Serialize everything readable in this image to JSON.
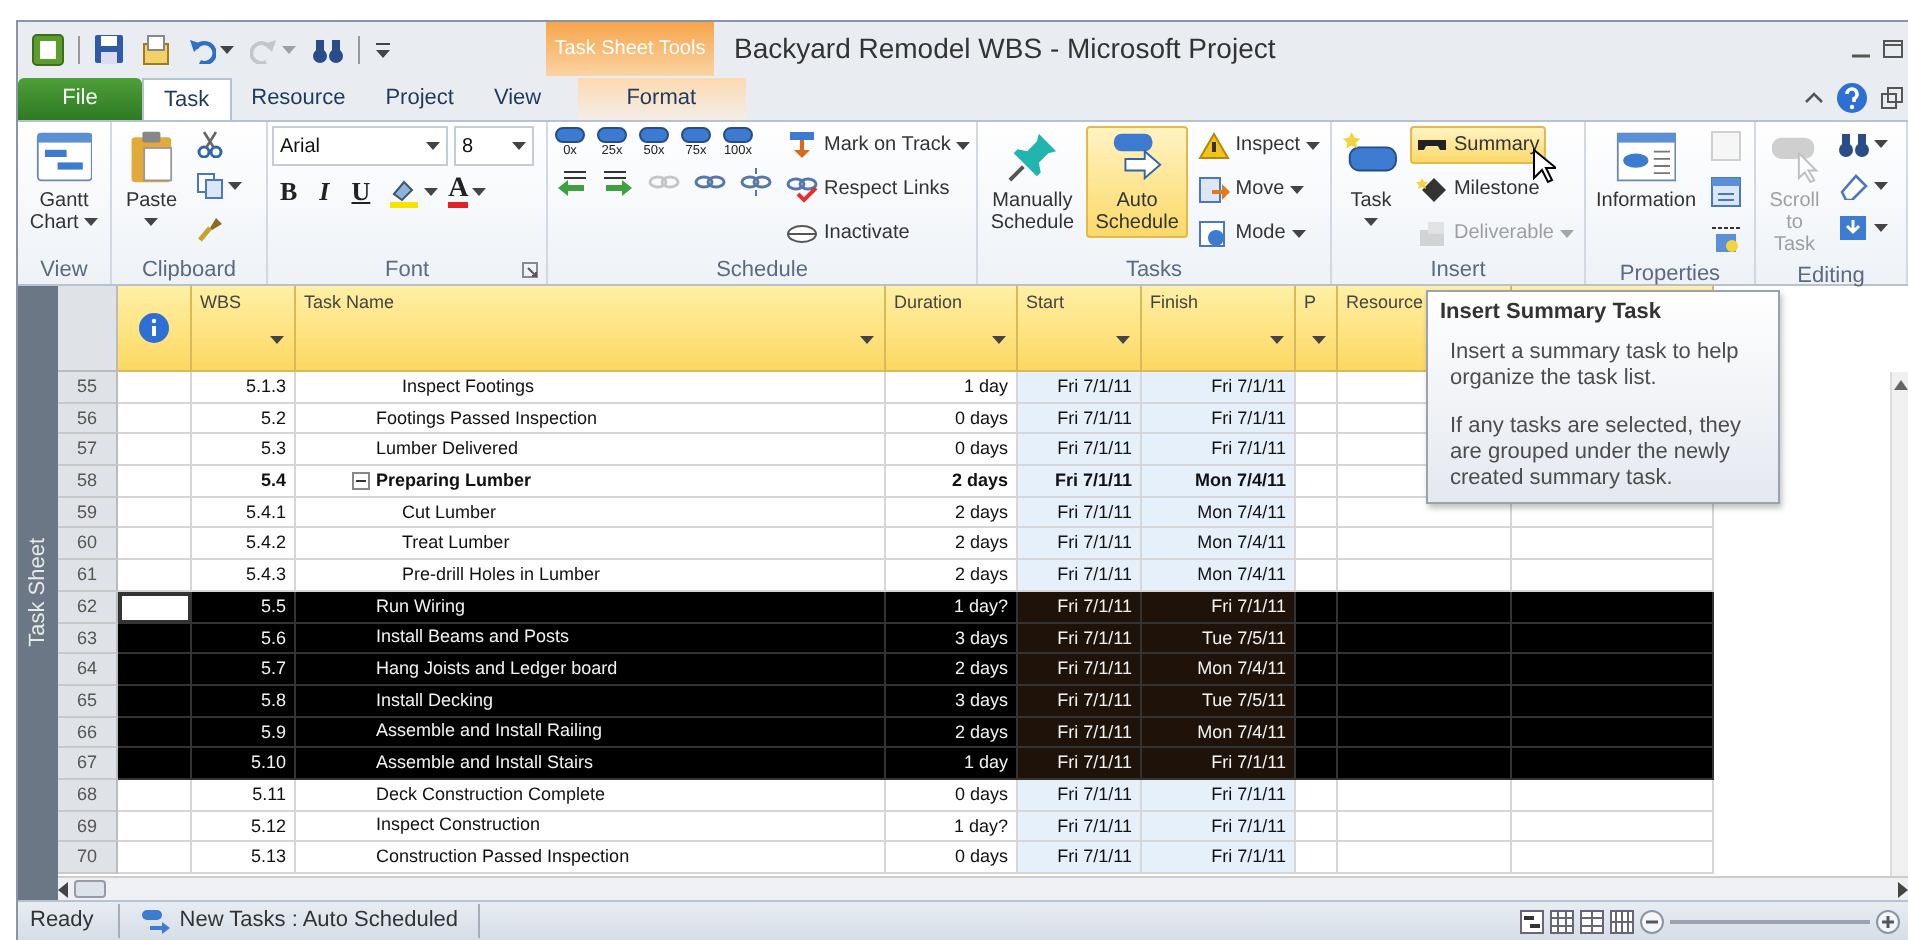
{
  "window": {
    "title": "Backyard Remodel WBS - Microsoft Project",
    "context_tab_group": "Task Sheet Tools"
  },
  "quick_access": [
    {
      "dropdown": false,
      "disabled": false
    },
    {
      "dropdown": false,
      "disabled": false
    },
    {
      "dropdown": false,
      "disabled": false
    },
    {
      "dropdown": true,
      "disabled": false
    },
    {
      "dropdown": true,
      "disabled": true
    },
    {
      "dropdown": false,
      "disabled": false
    },
    {
      "dropdown": false,
      "disabled": false
    }
  ],
  "tabs": [
    {
      "label": "File",
      "kind": "file",
      "selected": false
    },
    {
      "label": "Task",
      "kind": "normal",
      "selected": true
    },
    {
      "label": "Resource",
      "kind": "normal",
      "selected": false
    },
    {
      "label": "Project",
      "kind": "normal",
      "selected": false
    },
    {
      "label": "View",
      "kind": "normal",
      "selected": false
    },
    {
      "label": "Format",
      "kind": "contextual",
      "selected": false
    }
  ],
  "ribbon": [
    {
      "name": "View",
      "columns": [
        [
          [
            {
              "kind": "large",
              "label": "Gantt Chart",
              "dropdown": true,
              "disabled": false,
              "highlighted": false
            }
          ]
        ]
      ]
    },
    {
      "name": "Clipboard",
      "columns": [
        [
          [
            {
              "kind": "large",
              "label": "Paste",
              "dropdown": true,
              "disabled": false,
              "highlighted": false
            }
          ]
        ],
        [
          [
            {
              "kind": "icon",
              "dropdown": false,
              "disabled": false,
              "highlighted": false
            }
          ],
          [
            {
              "kind": "icon",
              "dropdown": true,
              "disabled": false,
              "highlighted": false
            }
          ],
          [
            {
              "kind": "icon",
              "dropdown": false,
              "disabled": false,
              "highlighted": false
            }
          ]
        ]
      ]
    },
    {
      "name": "Font",
      "launcher": true,
      "columns": [
        [
          [
            {
              "kind": "field",
              "value": "Arial",
              "dropdown": true,
              "disabled": false
            },
            {
              "kind": "field",
              "value": "8",
              "dropdown": true,
              "disabled": false
            }
          ],
          [
            {
              "kind": "format",
              "label": "B",
              "disabled": false
            },
            {
              "kind": "format",
              "label": "I",
              "disabled": false
            },
            {
              "kind": "format",
              "label": "U",
              "disabled": false
            },
            {
              "kind": "icon",
              "dropdown": true,
              "disabled": false,
              "highlighted": false
            },
            {
              "kind": "color",
              "label": "A",
              "dropdown": true,
              "disabled": false,
              "highlighted": false
            }
          ]
        ]
      ]
    },
    {
      "name": "Schedule",
      "columns": [
        [
          [
            {
              "kind": "percent",
              "label": "0x",
              "disabled": false
            },
            {
              "kind": "percent",
              "label": "25x",
              "disabled": false
            },
            {
              "kind": "percent",
              "label": "50x",
              "disabled": false
            },
            {
              "kind": "percent",
              "label": "75x",
              "disabled": false
            },
            {
              "kind": "percent",
              "label": "100x",
              "disabled": false
            }
          ],
          [
            {
              "kind": "icon",
              "dropdown": false,
              "disabled": false,
              "highlighted": false
            },
            {
              "kind": "icon",
              "dropdown": false,
              "disabled": false,
              "highlighted": false
            },
            {
              "kind": "icon",
              "dropdown": false,
              "disabled": true,
              "highlighted": false
            },
            {
              "kind": "icon",
              "dropdown": false,
              "disabled": false,
              "highlighted": false
            },
            {
              "kind": "icon",
              "dropdown": false,
              "disabled": false,
              "highlighted": false
            }
          ]
        ],
        [
          [
            {
              "kind": "small",
              "label": "Mark on Track",
              "dropdown": true,
              "disabled": false,
              "highlighted": false
            }
          ],
          [
            {
              "kind": "small",
              "label": "Respect Links",
              "dropdown": false,
              "disabled": false,
              "highlighted": false
            }
          ],
          [
            {
              "kind": "small",
              "label": "Inactivate",
              "dropdown": false,
              "disabled": false,
              "highlighted": false
            }
          ]
        ]
      ]
    },
    {
      "name": "Tasks",
      "columns": [
        [
          [
            {
              "kind": "large",
              "label": "Manually Schedule",
              "dropdown": false,
              "disabled": false,
              "highlighted": false
            }
          ]
        ],
        [
          [
            {
              "kind": "large",
              "label": "Auto Schedule",
              "dropdown": false,
              "disabled": false,
              "highlighted": true
            }
          ]
        ],
        [
          [
            {
              "kind": "small",
              "label": "Inspect",
              "dropdown": true,
              "disabled": false,
              "highlighted": false
            }
          ],
          [
            {
              "kind": "small",
              "label": "Move",
              "dropdown": true,
              "disabled": false,
              "highlighted": false
            }
          ],
          [
            {
              "kind": "small",
              "label": "Mode",
              "dropdown": true,
              "disabled": false,
              "highlighted": false
            }
          ]
        ]
      ]
    },
    {
      "name": "Insert",
      "columns": [
        [
          [
            {
              "kind": "large",
              "label": "Task",
              "dropdown": true,
              "disabled": false,
              "highlighted": false
            }
          ]
        ],
        [
          [
            {
              "kind": "small",
              "label": "Summary",
              "dropdown": false,
              "disabled": false,
              "highlighted": true
            }
          ],
          [
            {
              "kind": "small",
              "label": "Milestone",
              "dropdown": false,
              "disabled": false,
              "highlighted": false
            }
          ],
          [
            {
              "kind": "small",
              "label": "Deliverable",
              "dropdown": true,
              "disabled": true,
              "highlighted": false
            }
          ]
        ]
      ]
    },
    {
      "name": "Properties",
      "columns": [
        [
          [
            {
              "kind": "large",
              "label": "Information",
              "dropdown": false,
              "disabled": false,
              "highlighted": false
            }
          ]
        ],
        [
          [
            {
              "kind": "icon",
              "dropdown": false,
              "disabled": true,
              "highlighted": false
            }
          ],
          [
            {
              "kind": "icon",
              "dropdown": false,
              "disabled": false,
              "highlighted": false
            }
          ],
          [
            {
              "kind": "icon",
              "dropdown": false,
              "disabled": false,
              "highlighted": false
            }
          ]
        ]
      ]
    },
    {
      "name": "Editing",
      "columns": [
        [
          [
            {
              "kind": "large",
              "label": "Scroll to Task",
              "dropdown": false,
              "disabled": true,
              "highlighted": false
            }
          ]
        ],
        [
          [
            {
              "kind": "icon",
              "dropdown": true,
              "disabled": false,
              "highlighted": false
            }
          ],
          [
            {
              "kind": "icon",
              "dropdown": true,
              "disabled": false,
              "highlighted": false
            }
          ],
          [
            {
              "kind": "icon",
              "dropdown": true,
              "disabled": false,
              "highlighted": false
            }
          ]
        ]
      ]
    }
  ],
  "side_label": "Task Sheet",
  "table": {
    "columns": [
      {
        "kind": "indicator",
        "filter": false
      },
      {
        "label": "WBS",
        "kind": "wbs",
        "filter": true
      },
      {
        "label": "Task Name",
        "kind": "name",
        "filter": true
      },
      {
        "label": "Duration",
        "kind": "duration",
        "filter": true
      },
      {
        "label": "Start",
        "kind": "date",
        "filter": true
      },
      {
        "label": "Finish",
        "kind": "date",
        "filter": true
      },
      {
        "label": "P",
        "kind": "predecessors",
        "filter": true
      },
      {
        "label": "Resource",
        "kind": "resource"
      }
    ],
    "rows": [
      {
        "kind": "continuation",
        "children": [
          {
            "id": "55",
            "wbs": "5.1.3",
            "name": "Inspect Footings",
            "duration": "1 day",
            "start": "Fri 7/1/11",
            "finish": "Fri 7/1/11",
            "selected": false,
            "active": false,
            "summary": false
          }
        ]
      },
      {
        "id": "56",
        "wbs": "5.2",
        "name": "Footings Passed Inspection",
        "duration": "0 days",
        "start": "Fri 7/1/11",
        "finish": "Fri 7/1/11",
        "selected": false,
        "active": false,
        "summary": false
      },
      {
        "id": "57",
        "wbs": "5.3",
        "name": "Lumber Delivered",
        "duration": "0 days",
        "start": "Fri 7/1/11",
        "finish": "Fri 7/1/11",
        "selected": false,
        "active": false,
        "summary": false
      },
      {
        "id": "58",
        "wbs": "5.4",
        "name": "Preparing Lumber",
        "duration": "2 days",
        "start": "Fri 7/1/11",
        "finish": "Mon 7/4/11",
        "selected": false,
        "active": false,
        "summary": true,
        "expanded": true,
        "children": [
          {
            "id": "59",
            "wbs": "5.4.1",
            "name": "Cut Lumber",
            "duration": "2 days",
            "start": "Fri 7/1/11",
            "finish": "Mon 7/4/11",
            "selected": false,
            "active": false,
            "summary": false
          },
          {
            "id": "60",
            "wbs": "5.4.2",
            "name": "Treat Lumber",
            "duration": "2 days",
            "start": "Fri 7/1/11",
            "finish": "Mon 7/4/11",
            "selected": false,
            "active": false,
            "summary": false
          },
          {
            "id": "61",
            "wbs": "5.4.3",
            "name": "Pre-drill Holes in Lumber",
            "duration": "2 days",
            "start": "Fri 7/1/11",
            "finish": "Mon 7/4/11",
            "selected": false,
            "active": false,
            "summary": false
          }
        ]
      },
      {
        "id": "62",
        "wbs": "5.5",
        "name": "Run Wiring",
        "duration": "1 day?",
        "start": "Fri 7/1/11",
        "finish": "Fri 7/1/11",
        "selected": true,
        "active": true,
        "summary": false
      },
      {
        "id": "63",
        "wbs": "5.6",
        "name": "Install Beams and Posts",
        "duration": "3 days",
        "start": "Fri 7/1/11",
        "finish": "Tue 7/5/11",
        "selected": true,
        "active": false,
        "summary": false
      },
      {
        "id": "64",
        "wbs": "5.7",
        "name": "Hang Joists and Ledger board",
        "duration": "2 days",
        "start": "Fri 7/1/11",
        "finish": "Mon 7/4/11",
        "selected": true,
        "active": false,
        "summary": false
      },
      {
        "id": "65",
        "wbs": "5.8",
        "name": "Install Decking",
        "duration": "3 days",
        "start": "Fri 7/1/11",
        "finish": "Tue 7/5/11",
        "selected": true,
        "active": false,
        "summary": false
      },
      {
        "id": "66",
        "wbs": "5.9",
        "name": "Assemble and Install Railing",
        "duration": "2 days",
        "start": "Fri 7/1/11",
        "finish": "Mon 7/4/11",
        "selected": true,
        "active": false,
        "summary": false
      },
      {
        "id": "67",
        "wbs": "5.10",
        "name": "Assemble and Install Stairs",
        "duration": "1 day",
        "start": "Fri 7/1/11",
        "finish": "Fri 7/1/11",
        "selected": true,
        "active": false,
        "summary": false
      },
      {
        "id": "68",
        "wbs": "5.11",
        "name": "Deck Construction Complete",
        "duration": "0 days",
        "start": "Fri 7/1/11",
        "finish": "Fri 7/1/11",
        "selected": false,
        "active": false,
        "summary": false
      },
      {
        "id": "69",
        "wbs": "5.12",
        "name": "Inspect Construction",
        "duration": "1 day?",
        "start": "Fri 7/1/11",
        "finish": "Fri 7/1/11",
        "selected": false,
        "active": false,
        "summary": false
      },
      {
        "id": "70",
        "wbs": "5.13",
        "name": "Construction Passed Inspection",
        "duration": "0 days",
        "start": "Fri 7/1/11",
        "finish": "Fri 7/1/11",
        "selected": false,
        "active": false,
        "summary": false
      }
    ]
  },
  "tooltip": {
    "title": "Insert Summary Task",
    "paragraphs": [
      "Insert a summary task to help organize the task list.",
      "If any tasks are selected, they are grouped under the newly created summary task."
    ]
  },
  "status_bar": {
    "ready": "Ready",
    "task_mode": "New Tasks : Auto Scheduled"
  }
}
